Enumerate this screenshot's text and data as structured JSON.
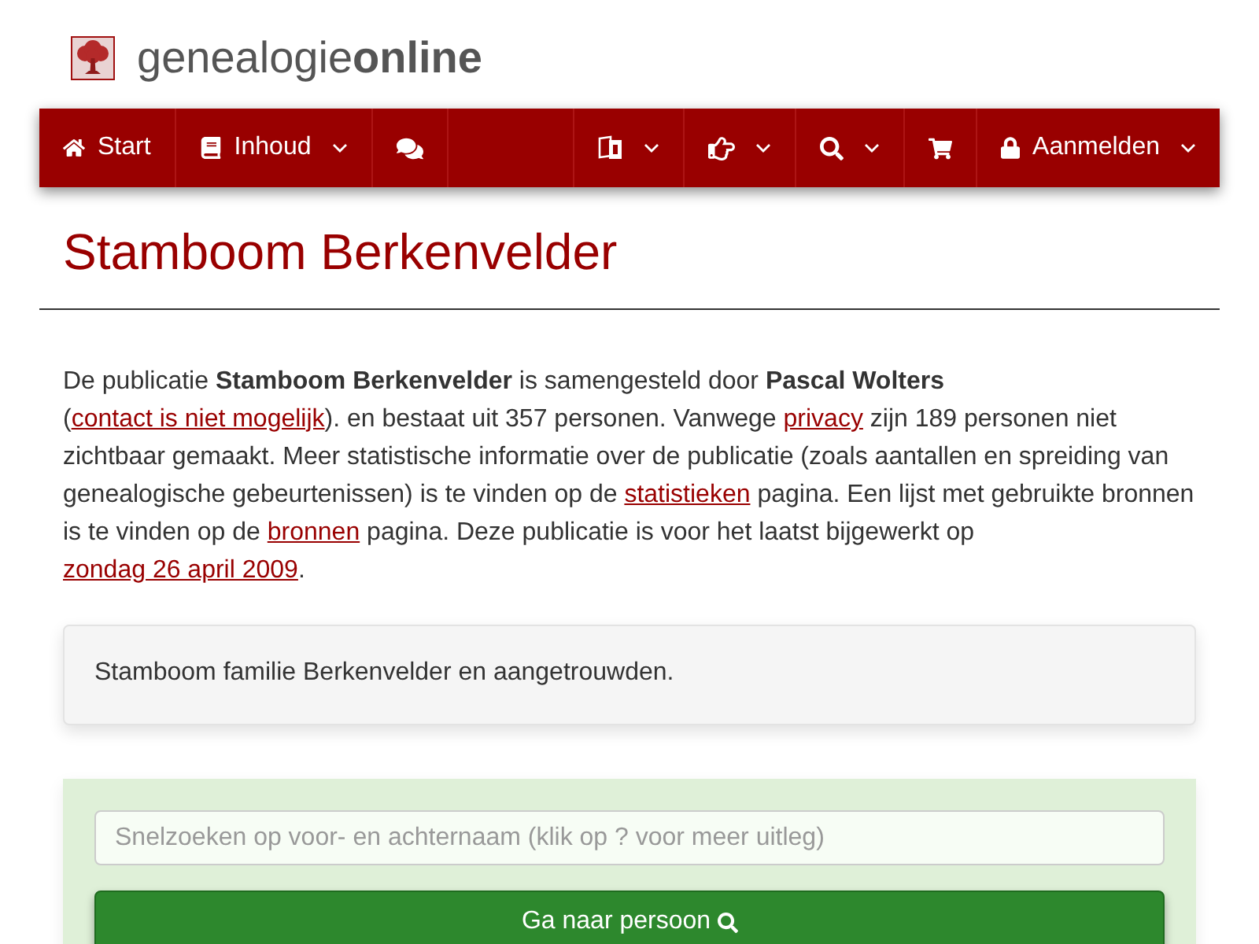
{
  "brand": {
    "name": "genealogie**online**"
  },
  "nav": {
    "left_items": [
      {
        "label": "Start",
        "dropdown": false
      },
      {
        "label": "Inhoud",
        "dropdown": true
      },
      {
        "dropdown": false
      }
    ],
    "right_items": [
      {
        "dropdown": true
      },
      {
        "dropdown": true
      },
      {
        "dropdown": true
      },
      {
        "dropdown": false
      },
      {
        "label": "Aanmelden",
        "dropdown": true
      }
    ]
  },
  "title": "Stamboom Berkenvelder",
  "intro": [
    {
      "kind": "text",
      "text": "De publicatie **Stamboom Berkenvelder** is samengesteld door **Pascal Wolters** ("
    },
    {
      "kind": "link",
      "text": "contact is niet mogelijk"
    },
    {
      "kind": "text",
      "text": "). en bestaat uit 357 personen. Vanwege "
    },
    {
      "kind": "link",
      "text": "privacy"
    },
    {
      "kind": "text",
      "text": " zijn 189 personen niet zichtbaar gemaakt. Meer statistische informatie over de publicatie (zoals aantallen en spreiding van genealogische gebeurtenissen) is te vinden op de "
    },
    {
      "kind": "link",
      "text": "statistieken"
    },
    {
      "kind": "text",
      "text": " pagina. Een lijst met gebruikte bronnen is te vinden op de "
    },
    {
      "kind": "link",
      "text": "bronnen"
    },
    {
      "kind": "text",
      "text": " pagina. Deze publicatie is voor het laatst bijgewerkt op "
    },
    {
      "kind": "link",
      "text": "zondag 26 april 2009"
    },
    {
      "kind": "text",
      "text": "."
    }
  ],
  "description": "Stamboom familie Berkenvelder en aangetrouwden.",
  "search": {
    "placeholder": "Snelzoeken op voor- en achternaam (klik op ? voor meer uitleg)",
    "button": "Ga naar persoon"
  }
}
